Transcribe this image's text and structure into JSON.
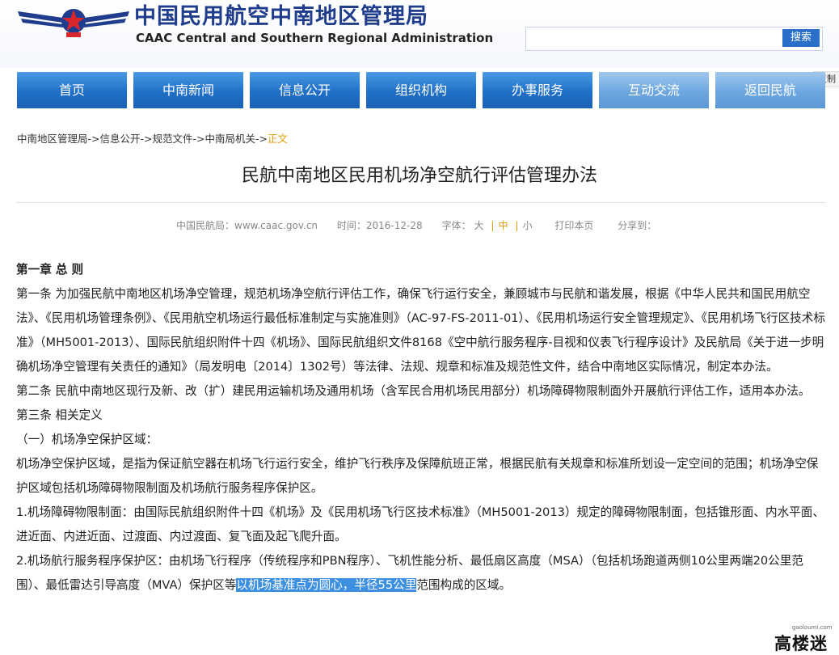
{
  "header": {
    "title_cn": "中国民用航空中南地区管理局",
    "title_en": "CAAC Central and Southern Regional Administration",
    "search": {
      "value": "",
      "button": "搜索"
    },
    "copy_label": "复制"
  },
  "nav": {
    "items": [
      {
        "label": "首页"
      },
      {
        "label": "中南新闻"
      },
      {
        "label": "信息公开"
      },
      {
        "label": "组织机构"
      },
      {
        "label": "办事服务"
      },
      {
        "label": "互动交流"
      },
      {
        "label": "返回民航"
      }
    ]
  },
  "breadcrumb": {
    "items": [
      "中南地区管理局",
      "信息公开",
      "规范文件",
      "中南局机关"
    ],
    "separator": "->",
    "current": "正文"
  },
  "article": {
    "title": "民航中南地区民用机场净空航行评估管理办法",
    "meta": {
      "source": "中国民航局：www.caac.gov.cn",
      "time": "时间：2016-12-28",
      "font_label": "字体：",
      "font_large": "大",
      "font_medium": "中",
      "font_small": "小",
      "print": "打印本页",
      "share": "分享到："
    },
    "chapter": "第一章 总 则",
    "paragraphs": [
      "第一条 为加强民航中南地区机场净空管理，规范机场净空航行评估工作，确保飞行运行安全，兼顾城市与民航和谐发展，根据《中华人民共和国民用航空法》、《民用机场管理条例》、《民用航空机场运行最低标准制定与实施准则》（AC-97-FS-2011-01）、《民用机场运行安全管理规定》、《民用机场飞行区技术标准》（MH5001-2013）、国际民航组织附件十四《机场》、国际民航组织文件8168《空中航行服务程序-目视和仪表飞行程序设计》及民航局《关于进一步明确机场净空管理有关责任的通知》（局发明电〔2014〕1302号）等法律、法规、规章和标准及规范性文件，结合中南地区实际情况，制定本办法。",
      "第二条 民航中南地区现行及新、改（扩）建民用运输机场及通用机场（含军民合用机场民用部分）机场障碍物限制面外开展航行评估工作，适用本办法。",
      "第三条 相关定义",
      "（一）机场净空保护区域：",
      "机场净空保护区域，是指为保证航空器在机场飞行运行安全，维护飞行秩序及保障航班正常，根据民航有关规章和标准所划设一定空间的范围；机场净空保护区域包括机场障碍物限制面及机场航行服务程序保护区。",
      "1.机场障碍物限制面：由国际民航组织附件十四《机场》及《民用机场飞行区技术标准》（MH5001-2013）规定的障碍物限制面，包括锥形面、内水平面、进近面、内进近面、过渡面、内过渡面、复飞面及起飞爬升面。"
    ],
    "last_paragraph": {
      "before": "2.机场航行服务程序保护区：由机场飞行程序（传统程序和PBN程序）、飞机性能分析、最低扇区高度（MSA）（包括机场跑道两侧10公里两端20公里范围）、最低雷达引导高度（MVA）保护区等",
      "highlight": "以机场基准点为圆心，半径55公里",
      "after": "范围构成的区域。"
    }
  },
  "watermark": {
    "text": "高楼迷",
    "small": "gaoloumi.com"
  },
  "colors": {
    "nav_blue": "#1f6fc8",
    "title_blue": "#1f3d8c",
    "current_orange": "#e39a00",
    "highlight": "#3d8fe0"
  }
}
